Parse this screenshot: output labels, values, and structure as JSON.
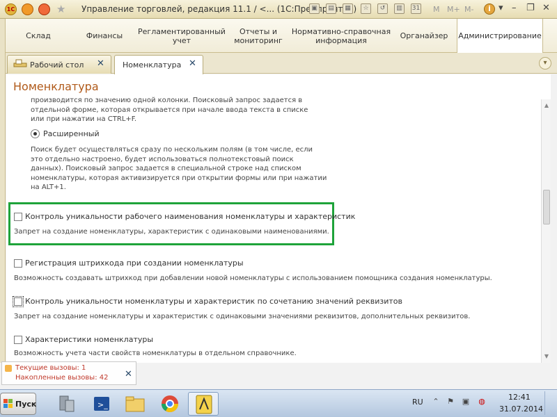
{
  "window": {
    "title": "Управление торговлей, редакция 11.1 / <...  (1С:Предприятие)",
    "toolbar_m": [
      "M",
      "M+",
      "M-"
    ]
  },
  "sections": [
    {
      "label": "Склад",
      "active": false
    },
    {
      "label": "Финансы",
      "active": false
    },
    {
      "label": "Регламентированный учет",
      "active": false
    },
    {
      "label": "Отчеты и мониторинг",
      "active": false
    },
    {
      "label": "Нормативно-справочная информация",
      "active": false
    },
    {
      "label": "Органайзер",
      "active": false
    },
    {
      "label": "Администрирование",
      "active": true
    }
  ],
  "tabs": [
    {
      "label": "Рабочий стол",
      "active": false
    },
    {
      "label": "Номенклатура",
      "active": true
    }
  ],
  "page": {
    "title": "Номенклатура",
    "search_desc_top": [
      "производится по значению одной колонки. Поисковый запрос задается в",
      "отдельной форме, которая открывается при начале ввода текста в списке",
      "или при нажатии на CTRL+F."
    ],
    "radio_extended": "Расширенный",
    "search_desc_extended": [
      "Поиск будет осуществляться сразу по нескольким полям (в том числе, если",
      "это отдельно настроено, будет использоваться полнотекстовый поиск",
      "данных). Поисковый запрос задается в специальной строке над списком",
      "номенклатуры, которая активизируется при открытии формы или при нажатии",
      "на ALT+1."
    ],
    "options": [
      {
        "label": "Контроль уникальности рабочего наименования номенклатуры и характеристик",
        "desc": "Запрет на создание номенклатуры, характеристик с одинаковыми наименованиями.",
        "checked": false
      },
      {
        "label": "Регистрация штрихкода при создании номенклатуры",
        "desc": "Возможность создавать штрихкод при добавлении новой номенклатуры с использованием помощника создания номенклатуры.",
        "checked": false
      },
      {
        "label": "Контроль уникальности номенклатуры и характеристик по сочетанию значений реквизитов",
        "desc": "Запрет на создание номенклатуры и характеристик с одинаковыми значениями реквизитов, дополнительных реквизитов.",
        "checked": false
      },
      {
        "label": "Характеристики номенклатуры",
        "desc": "Возможность учета части свойств номенклатуры в отдельном справочнике.",
        "checked": false
      }
    ]
  },
  "calls": {
    "current": "Текущие вызовы: 1",
    "accumulated": "Накопленные вызовы: 42"
  },
  "taskbar": {
    "start_label": "Пуск",
    "lang": "RU",
    "time": "12:41",
    "date": "31.07.2014"
  },
  "colors": {
    "highlight": "#1ea33a",
    "title_orange": "#b05a1a",
    "calls_red": "#c0392b"
  }
}
